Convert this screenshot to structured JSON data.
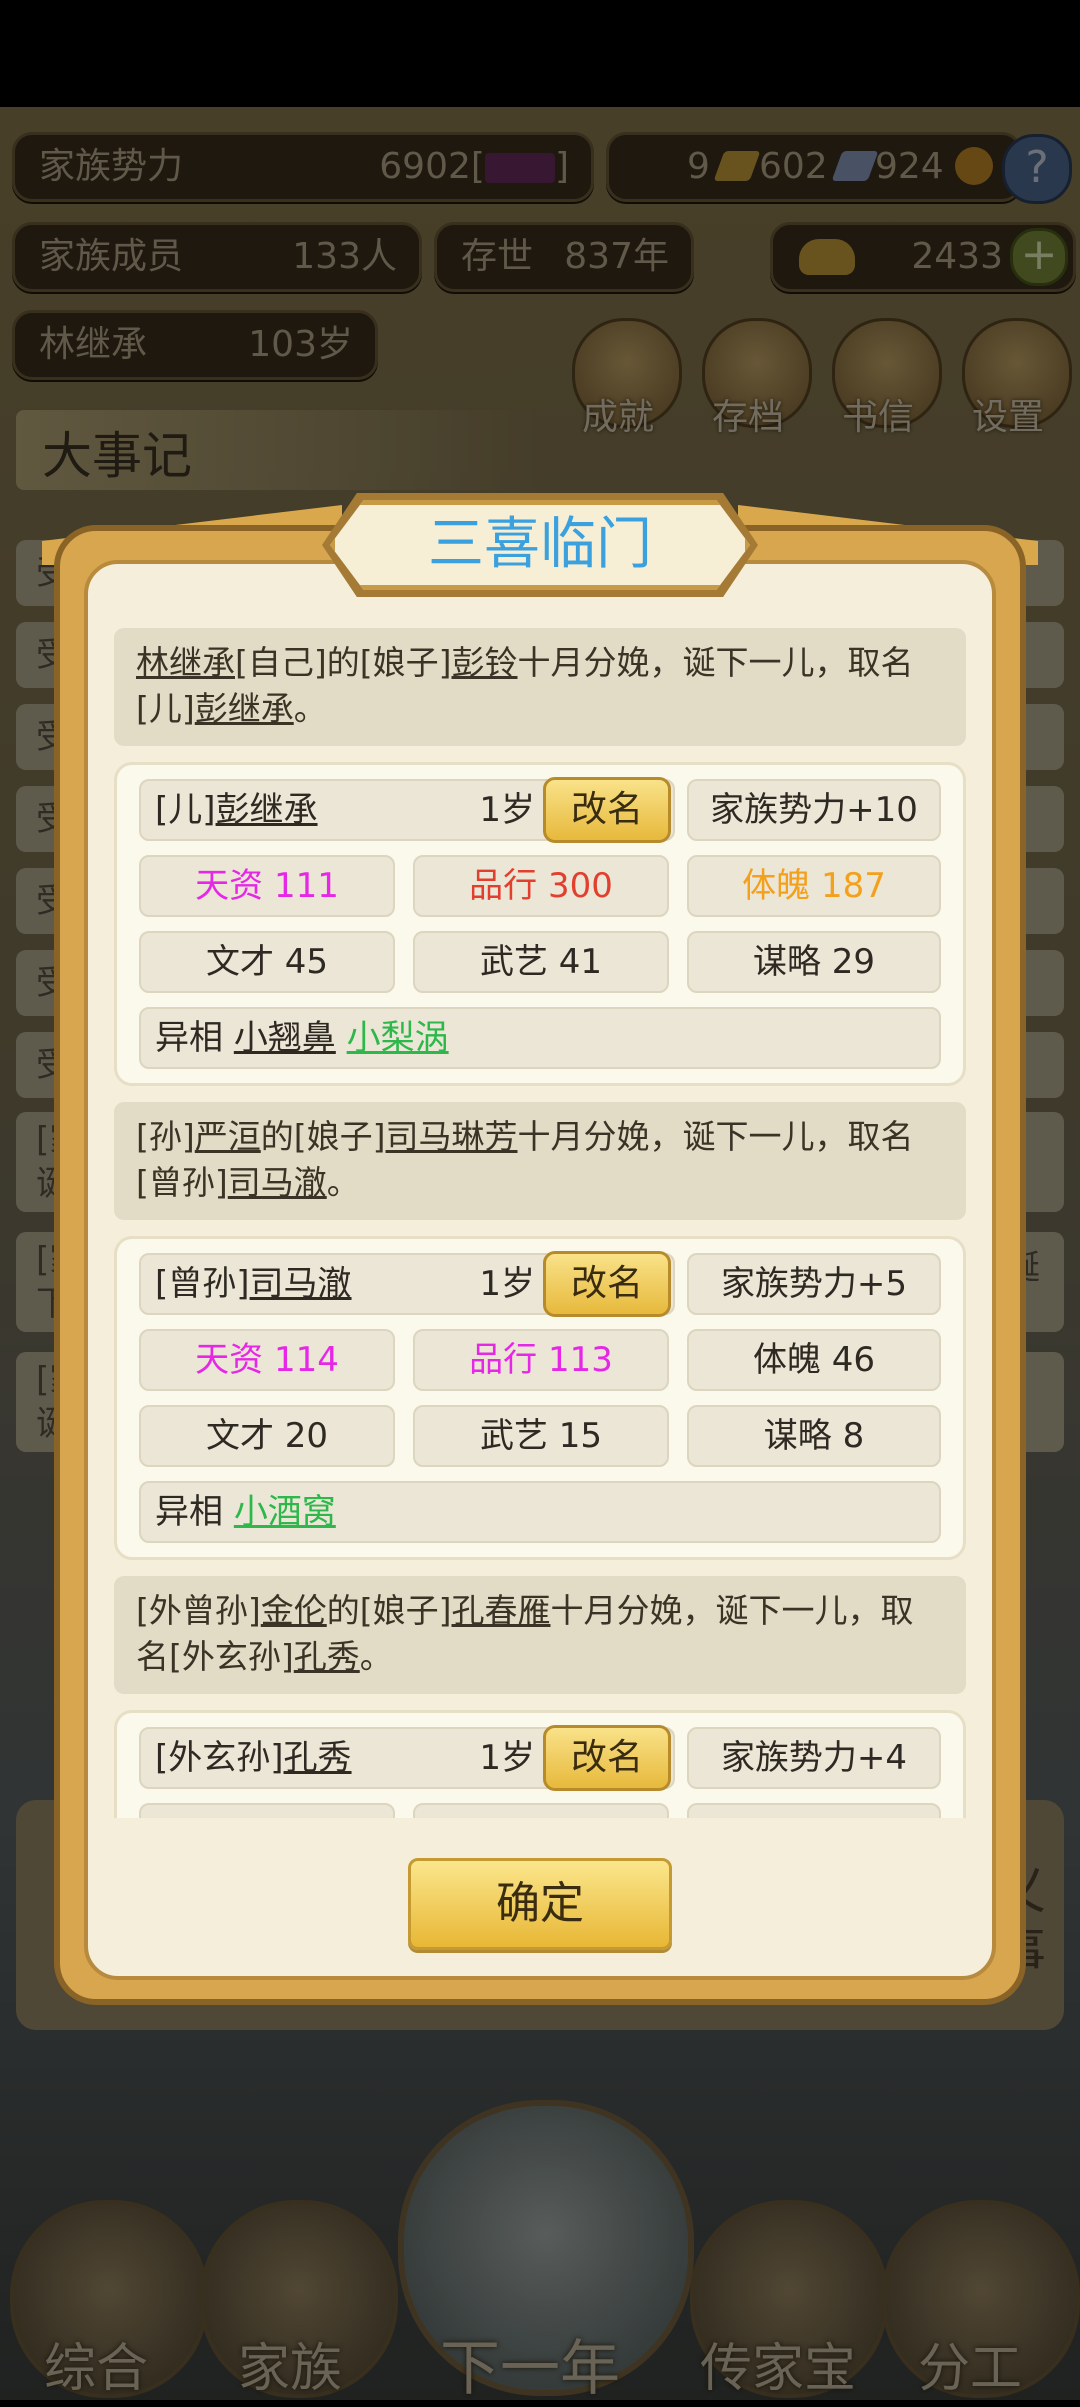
{
  "hud": {
    "family_power_label": "家族势力",
    "family_power_value": "6902[",
    "family_power_rank": "",
    "family_power_close": "]",
    "res_a": "9",
    "res_b": "602",
    "res_c": "924",
    "help": "?",
    "members_label": "家族成员",
    "members_value": "133人",
    "existence_label": "存世",
    "existence_value": "837年",
    "gold_value": "2433",
    "add": "+",
    "head_name": "林继承",
    "head_age": "103岁",
    "btn_achievement": "成就",
    "btn_save": "存档",
    "btn_letters": "书信",
    "btn_settings": "设置",
    "events_title": "大事记",
    "bg_rows": [
      "受",
      "受",
      "受",
      "受",
      "受",
      "受",
      "受",
      "[家",
      "[家",
      "[家"
    ],
    "bg_row_sub": [
      "诞",
      "下",
      "诞"
    ],
    "bg_right": "诞",
    "bg_right2": "义",
    "bg_right3": "事"
  },
  "nav": {
    "overview": "综合",
    "family": "家族",
    "next_year": "下一年",
    "heirloom": "传家宝",
    "division": "分工"
  },
  "modal": {
    "title": "三喜临门",
    "confirm": "确定",
    "events": [
      {
        "announce_parts": [
          "林继承",
          "[自己]的[娘子]",
          "彭铃",
          "十月分娩，诞下一儿，取名[儿]",
          "彭继承",
          "。"
        ],
        "name_prefix": "[儿]",
        "name": "彭继承",
        "age": "1岁",
        "rename": "改名",
        "power": "家族势力+10",
        "talent": "天资 111",
        "conduct": "品行 300",
        "physique": "体魄 187",
        "literary": "文才 45",
        "martial": "武艺 41",
        "strategy": "谋略 29",
        "traits_label": "异相",
        "traits": [
          "小翘鼻",
          "小梨涡"
        ]
      },
      {
        "announce_parts": [
          "[孙]",
          "严洹",
          "的[娘子]",
          "司马琳芳",
          "十月分娩，诞下一儿，取名[曾孙]",
          "司马澈",
          "。"
        ],
        "name_prefix": "[曾孙]",
        "name": "司马澈",
        "age": "1岁",
        "rename": "改名",
        "power": "家族势力+5",
        "talent": "天资 114",
        "conduct": "品行 113",
        "physique": "体魄 46",
        "literary": "文才 20",
        "martial": "武艺 15",
        "strategy": "谋略 8",
        "traits_label": "异相",
        "traits": [
          "小酒窝"
        ]
      },
      {
        "announce_parts": [
          "[外曾孙]",
          "金伦",
          "的[娘子]",
          "孔春雁",
          "十月分娩，诞下一儿，取名[外玄孙]",
          "孔秀",
          "。"
        ],
        "name_prefix": "[外玄孙]",
        "name": "孔秀",
        "age": "1岁",
        "rename": "改名",
        "power": "家族势力+4"
      }
    ]
  },
  "colors": {
    "title": "#3aa0de",
    "magenta": "#e628e6",
    "red": "#e2402e",
    "orange": "#f3a11d",
    "green": "#2eb84b"
  }
}
